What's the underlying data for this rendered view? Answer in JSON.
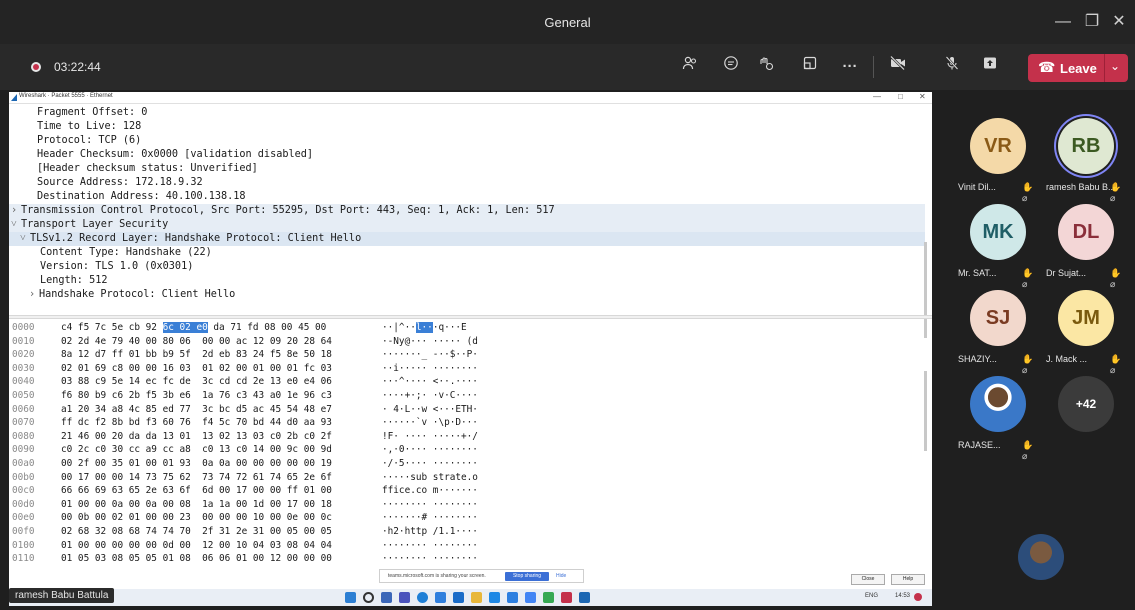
{
  "window": {
    "title": "General"
  },
  "meeting": {
    "timer": "03:22:44",
    "leave_label": "Leave"
  },
  "wireshark": {
    "window_title": "Wireshark · Packet 5555 · Ethernet",
    "tree": [
      {
        "indent": 2,
        "text": "Fragment Offset: 0"
      },
      {
        "indent": 2,
        "text": "Time to Live: 128"
      },
      {
        "indent": 2,
        "text": "Protocol: TCP (6)"
      },
      {
        "indent": 2,
        "text": "Header Checksum: 0x0000 [validation disabled]"
      },
      {
        "indent": 2,
        "text": "[Header checksum status: Unverified]"
      },
      {
        "indent": 2,
        "text": "Source Address: 172.18.9.32"
      },
      {
        "indent": 2,
        "text": "Destination Address: 40.100.138.18"
      },
      {
        "indent": 0,
        "marker": "›",
        "text": "Transmission Control Protocol, Src Port: 55295, Dst Port: 443, Seq: 1, Ack: 1, Len: 517"
      },
      {
        "indent": 0,
        "marker": "˅",
        "text": "Transport Layer Security"
      },
      {
        "indent": 1,
        "marker": "˅",
        "text": "TLSv1.2 Record Layer: Handshake Protocol: Client Hello"
      },
      {
        "indent": 3,
        "text": "Content Type: Handshake (22)"
      },
      {
        "indent": 3,
        "text": "Version: TLS 1.0 (0x0301)"
      },
      {
        "indent": 3,
        "text": "Length: 512"
      },
      {
        "indent": 2,
        "marker": "›",
        "text": "Handshake Protocol: Client Hello"
      }
    ],
    "hex_rows": [
      {
        "off": "0000",
        "a": "c4 f5 7c 5e cb 92 ",
        "m": "6c 02 e0",
        "b": " da 71 fd 08 00 45 00",
        "asc1": "··|^··",
        "ascm": "l··",
        "asc2": "·q···E"
      },
      {
        "off": "0010",
        "a": "02 2d 4e 79 40 00 80 06  00 00 ac 12 09 20 28 64",
        "asc1": "·-Ny@··· ····· (d"
      },
      {
        "off": "0020",
        "a": "8a 12 d7 ff 01 bb b9 5f  2d eb 83 24 f5 8e 50 18",
        "asc1": "·······_ -··$··P·"
      },
      {
        "off": "0030",
        "a": "02 01 69 c8 00 00 16 03  01 02 00 01 00 01 fc 03",
        "asc1": "··i····· ········"
      },
      {
        "off": "0040",
        "a": "03 88 c9 5e 14 ec fc de  3c cd cd 2e 13 e0 e4 06",
        "asc1": "···^···· <··.····"
      },
      {
        "off": "0050",
        "a": "f6 80 b9 c6 2b f5 3b e6  1a 76 c3 43 a0 1e 96 c3",
        "asc1": "····+·;· ·v·C····"
      },
      {
        "off": "0060",
        "a": "a1 20 34 a8 4c 85 ed 77  3c bc d5 ac 45 54 48 e7",
        "asc1": "· 4·L··w <···ETH·"
      },
      {
        "off": "0070",
        "a": "ff dc f2 8b bd f3 60 76  f4 5c 70 bd 44 d0 aa 93",
        "asc1": "······`v ·\\p·D···"
      },
      {
        "off": "0080",
        "a": "21 46 00 20 da da 13 01  13 02 13 03 c0 2b c0 2f",
        "asc1": "!F· ···· ·····+·/"
      },
      {
        "off": "0090",
        "a": "c0 2c c0 30 cc a9 cc a8  c0 13 c0 14 00 9c 00 9d",
        "asc1": "·,·0···· ········"
      },
      {
        "off": "00a0",
        "a": "00 2f 00 35 01 00 01 93  0a 0a 00 00 00 00 00 19",
        "asc1": "·/·5···· ········"
      },
      {
        "off": "00b0",
        "a": "00 17 00 00 14 73 75 62  73 74 72 61 74 65 2e 6f",
        "asc1": "·····sub strate.o"
      },
      {
        "off": "00c0",
        "a": "66 66 69 63 65 2e 63 6f  6d 00 17 00 00 ff 01 00",
        "asc1": "ffice.co m·······"
      },
      {
        "off": "00d0",
        "a": "01 00 00 0a 00 0a 00 08  1a 1a 00 1d 00 17 00 18",
        "asc1": "········ ········"
      },
      {
        "off": "00e0",
        "a": "00 0b 00 02 01 00 00 23  00 00 00 10 00 0e 00 0c",
        "asc1": "·······# ········"
      },
      {
        "off": "00f0",
        "a": "02 68 32 08 68 74 74 70  2f 31 2e 31 00 05 00 05",
        "asc1": "·h2·http /1.1····"
      },
      {
        "off": "0100",
        "a": "01 00 00 00 00 00 0d 00  12 00 10 04 03 08 04 04",
        "asc1": "········ ········"
      },
      {
        "off": "0110",
        "a": "01 05 03 08 05 05 01 08  06 06 01 00 12 00 00 00",
        "asc1": "········ ········"
      }
    ],
    "share_message": "teams.microsoft.com is sharing your screen.",
    "stop_sharing": "Stop sharing",
    "hide": "Hide",
    "close_btn": "Close",
    "help_btn": "Help",
    "tray_lang": "ENG",
    "tray_time": "14:53"
  },
  "presenter_name": "ramesh Babu Battula",
  "participants": [
    {
      "initials": "VR",
      "name": "Vinit Dil...",
      "bg": "#f4d9a8",
      "fg": "#8a5a16"
    },
    {
      "initials": "RB",
      "name": "ramesh Babu B...",
      "bg": "#dfe8d2",
      "fg": "#3c5a22",
      "speaking": true
    },
    {
      "initials": "MK",
      "name": "Mr. SAT...",
      "bg": "#cfe8e8",
      "fg": "#1f5e66"
    },
    {
      "initials": "DL",
      "name": "Dr Sujat...",
      "bg": "#f3d6d6",
      "fg": "#8a2f3a"
    },
    {
      "initials": "SJ",
      "name": "SHAZIY...",
      "bg": "#f2d8cc",
      "fg": "#7a3b22"
    },
    {
      "initials": "JM",
      "name": "J. Mack ...",
      "bg": "#fbe7a4",
      "fg": "#7a5a0e"
    },
    {
      "initials": "",
      "name": "RAJASE...",
      "photo": true
    },
    {
      "initials": "+42",
      "name": "",
      "bg": "#3b3b3b",
      "fg": "#ffffff"
    }
  ]
}
